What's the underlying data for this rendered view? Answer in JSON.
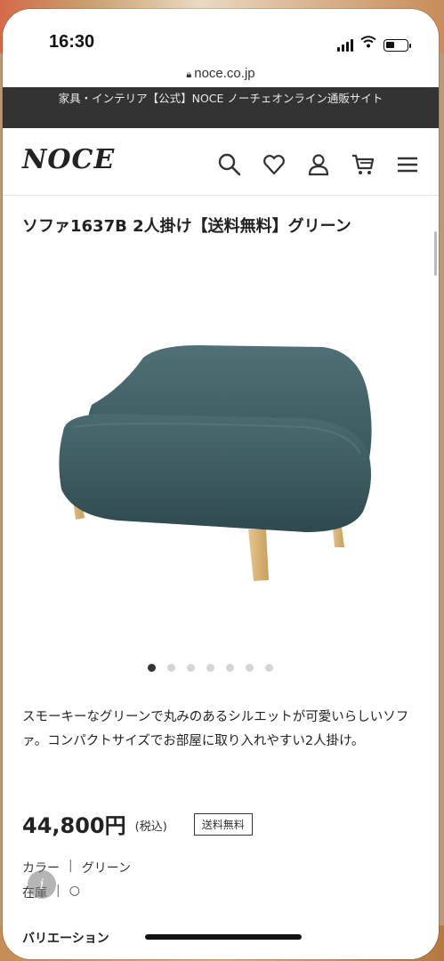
{
  "status_bar": {
    "time": "16:30"
  },
  "browser": {
    "url": "noce.co.jp"
  },
  "promo_banner": {
    "text": "家具・インテリア【公式】NOCE ノーチェオンライン通販サイト"
  },
  "header": {
    "logo": "NOCE",
    "icons": [
      "search-icon",
      "favorite-heart-icon",
      "account-icon",
      "cart-icon",
      "menu-icon"
    ]
  },
  "product": {
    "title": "ソファ1637B 2人掛け【送料無料】グリーン",
    "image_alt": "sofa-green-2-seater",
    "carousel": {
      "total": 7,
      "active_index": 0
    },
    "description": "スモーキーなグリーンで丸みのあるシルエットが可愛いらしいソファ。コンパクトサイズでお部屋に取り入れやすい2人掛け。",
    "price": "44,800円",
    "tax_note": "(税込)",
    "shipping_badge": "送料無料",
    "color_label": "カラー",
    "color_value": "グリーン",
    "stock_label": "在庫",
    "stock_value": "○",
    "variation_label": "バリエーション"
  },
  "colors": {
    "sofa": "#3f5e63",
    "legs": "#d9b57a",
    "promo_bg": "#333333"
  }
}
